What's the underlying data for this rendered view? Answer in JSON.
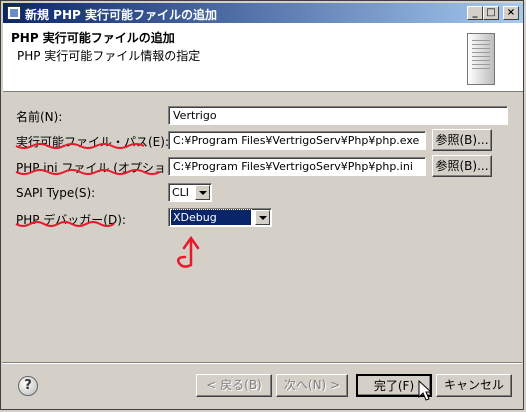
{
  "window": {
    "title": "新規 PHP 実行可能ファイルの追加",
    "minimize_label": "_",
    "maximize_label": "□",
    "close_label": "×"
  },
  "header": {
    "title": "PHP 実行可能ファイルの追加",
    "subtitle": "PHP 実行可能ファイル情報の指定"
  },
  "form": {
    "name_label": "名前(N):",
    "name_value": "Vertrigo",
    "exe_label": "実行可能ファイル・パス(E):",
    "exe_value": "C:¥Program Files¥VertrigoServ¥Php¥php.exe",
    "exe_browse": "参照(B)...",
    "ini_label": "PHP ini ファイル (オプション)(I):",
    "ini_value": "C:¥Program Files¥VertrigoServ¥Php¥php.ini",
    "ini_browse": "参照(B)...",
    "sapi_label": "SAPI Type(S):",
    "sapi_value": "CLI",
    "debugger_label": "PHP デバッガー(D):",
    "debugger_value": "XDebug"
  },
  "footer": {
    "help_label": "?",
    "back_label": "< 戻る(B)",
    "next_label": "次へ(N) >",
    "finish_label": "完了(F)",
    "cancel_label": "キャンセル"
  },
  "colors": {
    "annotation": "#e8192c",
    "titlebar_start": "#0a246a",
    "titlebar_end": "#a6caf0",
    "selection": "#0a246a"
  }
}
